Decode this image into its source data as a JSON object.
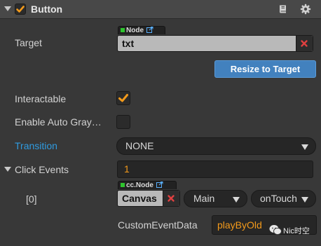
{
  "component": {
    "title": "Button",
    "enabled": true,
    "icons": [
      "book-icon",
      "gear-icon"
    ]
  },
  "target": {
    "label": "Target",
    "type_tag": "Node",
    "value": "txt"
  },
  "resize_button": {
    "label": "Resize to Target",
    "color": "#4281be"
  },
  "interactable": {
    "label": "Interactable",
    "checked": true
  },
  "auto_gray": {
    "label": "Enable Auto Gray…",
    "checked": false
  },
  "transition": {
    "label": "Transition",
    "value": "NONE",
    "label_color": "#2f9be0"
  },
  "click_events": {
    "label": "Click Events",
    "count": "1",
    "items": [
      {
        "index_label": "[0]",
        "type_tag": "cc.Node",
        "target": "Canvas",
        "component": "Main",
        "handler": "onTouch",
        "custom_data_label": "CustomEventData",
        "custom_data": "playByOld"
      }
    ]
  },
  "watermark": {
    "text": "Nic时空"
  },
  "colors": {
    "background": "#383838",
    "header": "#484848",
    "check_accent": "#f39a1b",
    "value_accent": "#f39a1b",
    "clear_icon": "#e04040"
  }
}
